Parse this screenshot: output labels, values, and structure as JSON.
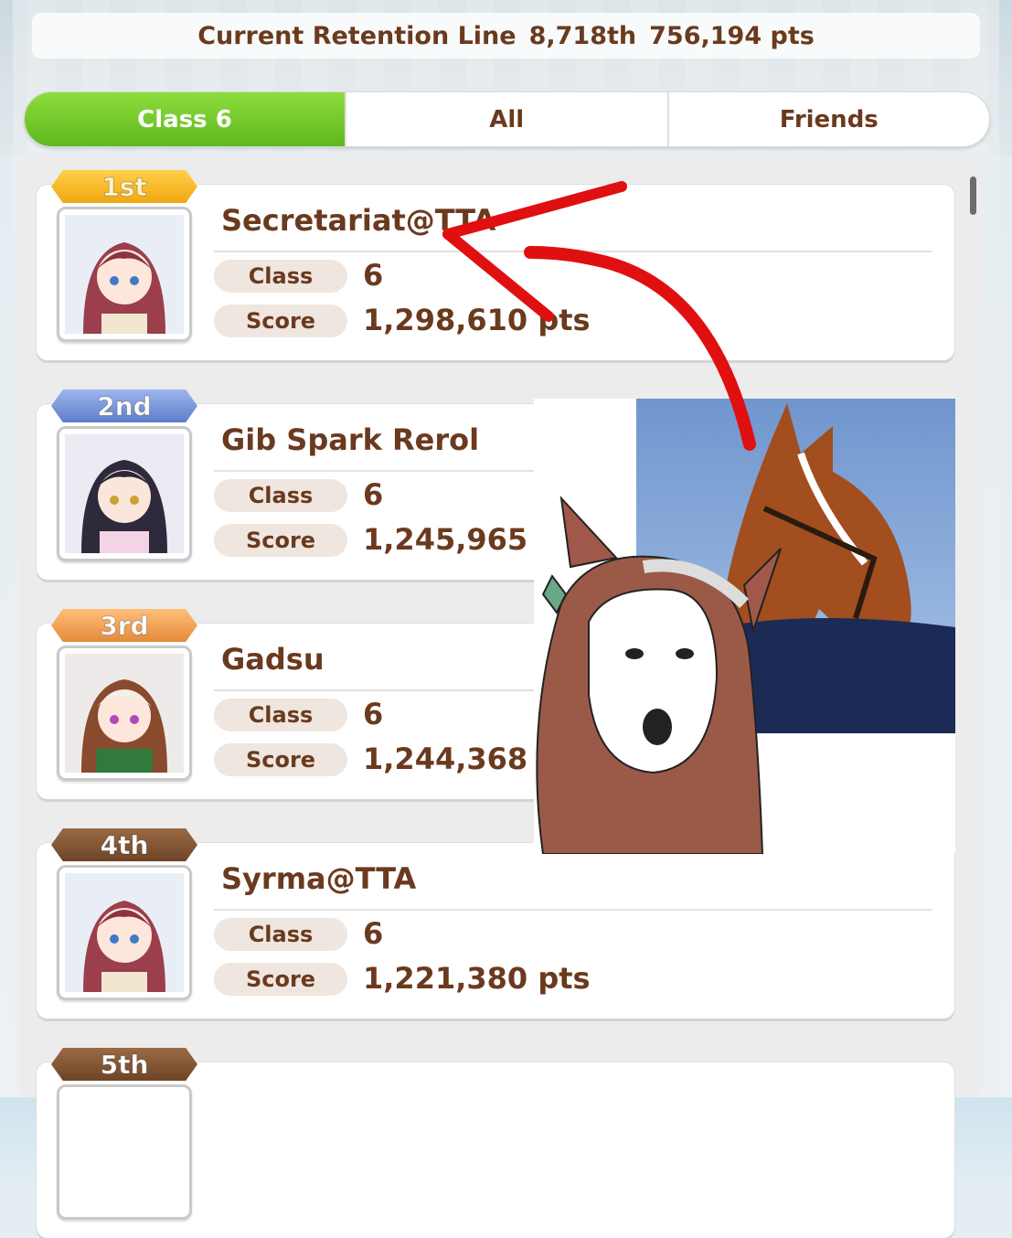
{
  "header": {
    "retention_label": "Current Retention Line",
    "retention_rank": "8,718th",
    "retention_points": "756,194 pts"
  },
  "tabs": [
    {
      "label": "Class 6",
      "active": true
    },
    {
      "label": "All",
      "active": false
    },
    {
      "label": "Friends",
      "active": false
    }
  ],
  "labels": {
    "class": "Class",
    "score": "Score"
  },
  "entries": [
    {
      "rank": "1st",
      "name": "Secretariat@TTA",
      "class": "6",
      "score": "1,298,610 pts"
    },
    {
      "rank": "2nd",
      "name": "Gib Spark Rerol",
      "class": "6",
      "score": "1,245,965"
    },
    {
      "rank": "3rd",
      "name": "Gadsu",
      "class": "6",
      "score": "1,244,368"
    },
    {
      "rank": "4th",
      "name": "Syrma@TTA",
      "class": "6",
      "score": "1,221,380 pts"
    },
    {
      "rank": "5th",
      "name": "",
      "class": "",
      "score": ""
    }
  ],
  "colors": {
    "text_brown": "#6b3a1e",
    "tab_active": "#6cc42a",
    "arrow": "#e01010"
  }
}
